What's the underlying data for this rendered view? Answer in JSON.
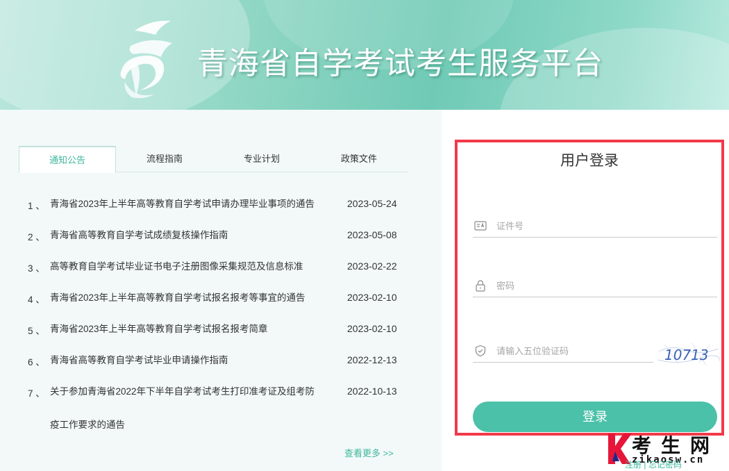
{
  "header": {
    "site_title": "青海省自学考试考生服务平台",
    "logo_icon": "qinghai-zikao-logo-icon"
  },
  "tabs": [
    {
      "label": "通知公告",
      "active": true
    },
    {
      "label": "流程指南",
      "active": false
    },
    {
      "label": "专业计划",
      "active": false
    },
    {
      "label": "政策文件",
      "active": false
    }
  ],
  "notices": [
    {
      "num": "1 、",
      "title": "青海省2023年上半年高等教育自学考试申请办理毕业事项的通告",
      "date": "2023-05-24"
    },
    {
      "num": "2 、",
      "title": "青海省高等教育自学考试成绩复核操作指南",
      "date": "2023-05-08"
    },
    {
      "num": "3 、",
      "title": "高等教育自学考试毕业证书电子注册图像采集规范及信息标准",
      "date": "2023-02-22"
    },
    {
      "num": "4 、",
      "title": "青海省2023年上半年高等教育自学考试报名报考等事宜的通告",
      "date": "2023-02-10"
    },
    {
      "num": "5 、",
      "title": "青海省2023年上半年高等教育自学考试报名报考简章",
      "date": "2023-02-10"
    },
    {
      "num": "6 、",
      "title": "青海省高等教育自学考试毕业申请操作指南",
      "date": "2022-12-13"
    },
    {
      "num": "7 、",
      "title": "关于参加青海省2022年下半年自学考试考生打印准考证及组考防",
      "title2": "疫工作要求的通告",
      "date": "2022-10-13"
    }
  ],
  "more_link": "查看更多 >>",
  "login": {
    "title": "用户登录",
    "id_placeholder": "证件号",
    "pwd_placeholder": "密码",
    "captcha_placeholder": "请输入五位验证码",
    "captcha_code": "10713",
    "button_label": "登录",
    "id_icon": "id-card-icon",
    "pwd_icon": "lock-icon",
    "captcha_icon": "shield-check-icon"
  },
  "sub_links": {
    "register": "注册",
    "separator": "|",
    "forgot": "忘记密码"
  },
  "watermark": {
    "brand_cn": "考生网",
    "brand_en": "zikaosw.cn"
  },
  "colors": {
    "accent": "#4cc1a9",
    "highlight_border": "#f2394a"
  }
}
